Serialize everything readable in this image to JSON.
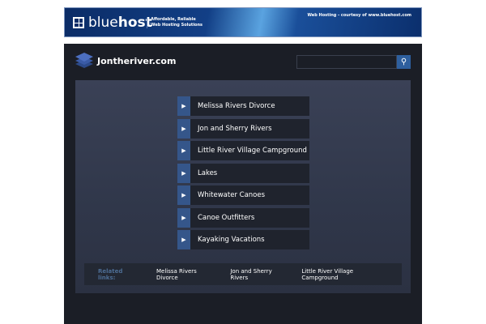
{
  "banner": {
    "brand_light": "blue",
    "brand_bold": "host",
    "tagline_1": "Affordable, Reliable",
    "tagline_2": "Web Hosting Solutions",
    "courtesy": "Web Hosting - courtesy of www.bluehost.com"
  },
  "header": {
    "site_name": "Jontheriver.com",
    "search_placeholder": "",
    "search_icon": "magnifier"
  },
  "links": [
    {
      "label": "Melissa Rivers Divorce"
    },
    {
      "label": "Jon and Sherry Rivers"
    },
    {
      "label": "Little River Village Campground"
    },
    {
      "label": "Lakes"
    },
    {
      "label": "Whitewater Canoes"
    },
    {
      "label": "Canoe Outfitters"
    },
    {
      "label": "Kayaking Vacations"
    }
  ],
  "related": {
    "label": "Related links:",
    "items": [
      "Melissa Rivers Divorce",
      "Jon and Sherry Rivers",
      "Little River Village Campground"
    ]
  }
}
